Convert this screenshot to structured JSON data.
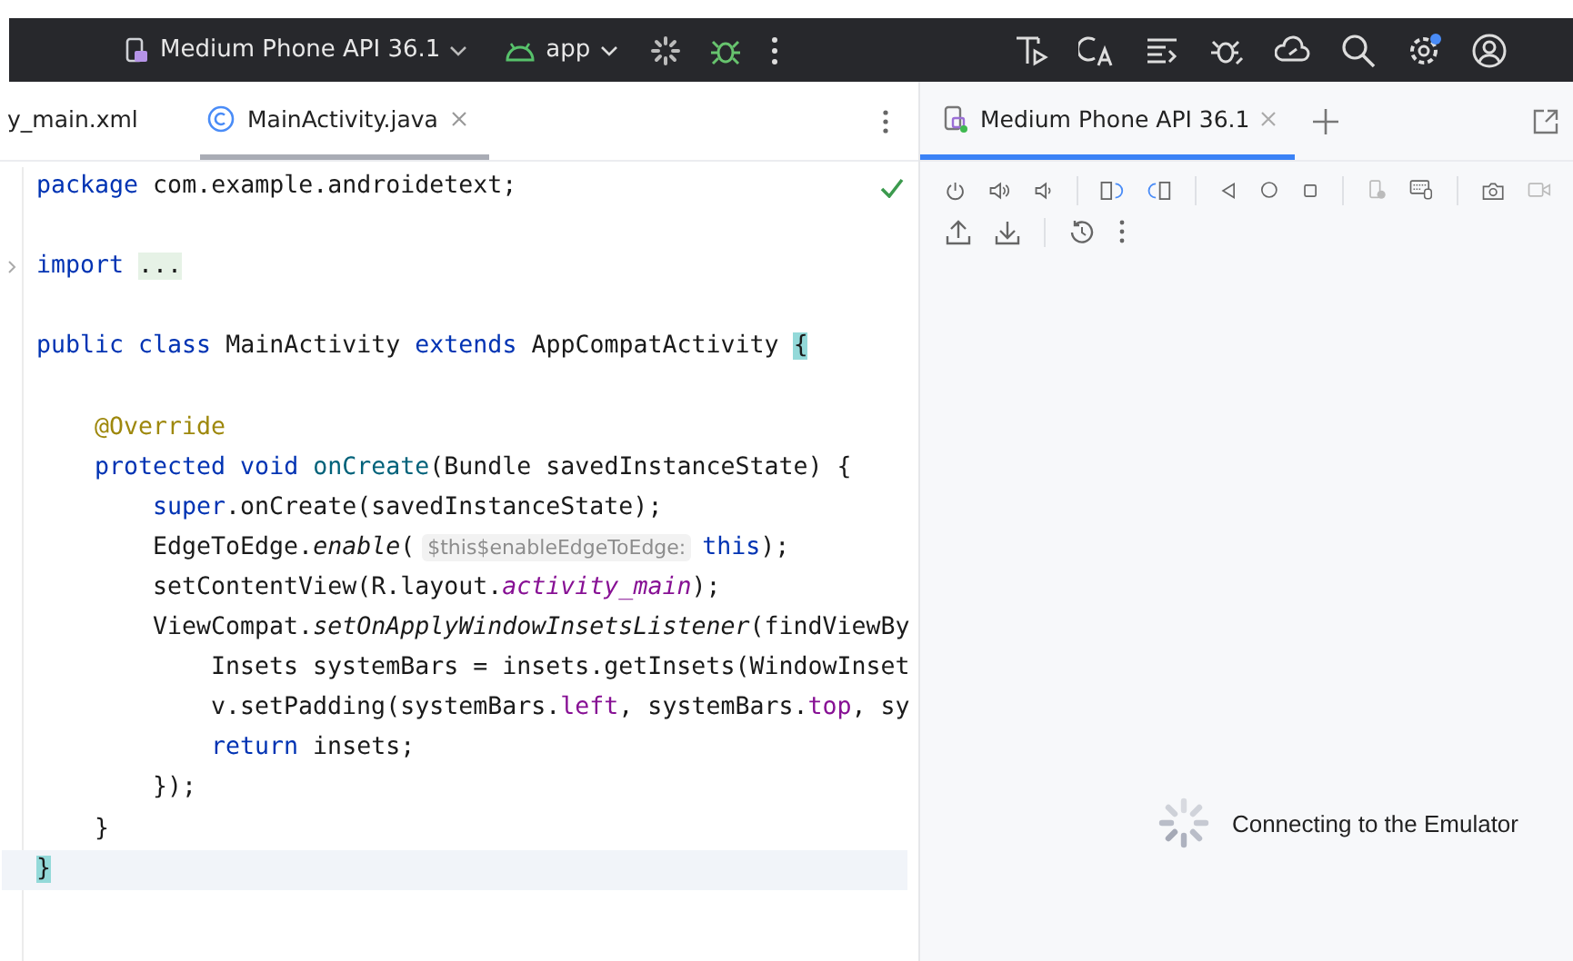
{
  "toolbar": {
    "device": "Medium Phone API 36.1",
    "config": "app"
  },
  "editor_tabs": [
    {
      "label": "y_main.xml",
      "selected": false
    },
    {
      "label": "MainActivity.java",
      "selected": true
    }
  ],
  "emulator_tabs": [
    {
      "label": "Medium Phone API 36.1",
      "selected": true
    }
  ],
  "code": [
    {
      "current": false,
      "tokens": [
        {
          "kind": "keyword",
          "text": "package"
        },
        {
          "kind": "plain",
          "text": " com.example.androidetext;"
        }
      ]
    },
    {
      "current": false
    },
    {
      "current": false,
      "folded": true,
      "tokens": [
        {
          "kind": "keyword",
          "text": "import"
        },
        {
          "kind": "folded",
          "text": "..."
        }
      ]
    },
    {
      "current": false
    },
    {
      "current": false,
      "tokens": [
        {
          "kind": "keyword",
          "text": "public class"
        },
        {
          "kind": "plain",
          "text": " MainActivity "
        },
        {
          "kind": "keyword",
          "text": "extends"
        },
        {
          "kind": "plain",
          "text": " AppCompatActivity "
        },
        {
          "kind": "brace",
          "text": "{"
        }
      ],
      "children": [
        {
          "current": false
        },
        {
          "current": false,
          "tokens": [
            {
              "kind": "annotation",
              "text": "@Override"
            }
          ]
        },
        {
          "current": false,
          "tokens": [
            {
              "kind": "keyword",
              "text": "protected void"
            },
            {
              "kind": "function",
              "text": "onCreate"
            },
            {
              "kind": "plain",
              "text": "(Bundle savedInstanceState) {"
            }
          ],
          "children": [
            {
              "current": false,
              "tokens": [
                {
                  "kind": "keyword",
                  "text": "super"
                },
                {
                  "kind": "plain",
                  "text": ".onCreate(savedInstanceState);"
                }
              ]
            },
            {
              "current": false,
              "tokens": [
                {
                  "kind": "plain",
                  "text": "EdgeToEdge."
                },
                {
                  "kind": "static",
                  "text": "enable"
                },
                {
                  "kind": "plain",
                  "text": "("
                },
                {
                  "kind": "hint",
                  "text": "$this$enableEdgeToEdge:"
                },
                {
                  "kind": "keyword",
                  "text": "this"
                },
                {
                  "kind": "plain",
                  "text": ");"
                }
              ]
            },
            {
              "current": false,
              "tokens": [
                {
                  "kind": "plain",
                  "text": "setContentView(R.layout."
                },
                {
                  "kind": "static-field",
                  "text": "activity_main"
                },
                {
                  "kind": "plain",
                  "text": ");"
                }
              ]
            },
            {
              "current": false,
              "tokens": [
                {
                  "kind": "plain",
                  "text": "ViewCompat."
                },
                {
                  "kind": "static",
                  "text": "setOnApplyWindowInsetsListener"
                },
                {
                  "kind": "plain",
                  "text": "(findViewBy"
                }
              ],
              "children": [
                {
                  "current": false,
                  "tokens": [
                    {
                      "kind": "plain",
                      "text": "Insets systemBars = insets.getInsets(WindowInset"
                    }
                  ]
                },
                {
                  "current": false,
                  "tokens": [
                    {
                      "kind": "plain",
                      "text": "v.setPadding(systemBars."
                    },
                    {
                      "kind": "field",
                      "text": "left"
                    },
                    {
                      "kind": "plain",
                      "text": ", systemBars."
                    },
                    {
                      "kind": "field",
                      "text": "top"
                    },
                    {
                      "kind": "plain",
                      "text": ", sy"
                    }
                  ]
                },
                {
                  "current": false,
                  "tokens": [
                    {
                      "kind": "keyword",
                      "text": "return"
                    },
                    {
                      "kind": "plain",
                      "text": " insets;"
                    }
                  ]
                }
              ]
            },
            {
              "current": false,
              "tokens": [
                {
                  "kind": "plain",
                  "text": "});"
                }
              ]
            }
          ]
        },
        {
          "current": false,
          "tokens": [
            {
              "kind": "plain",
              "text": "}"
            }
          ]
        }
      ]
    },
    {
      "current": true,
      "tokens": [
        {
          "kind": "brace",
          "text": "}"
        }
      ]
    }
  ],
  "emulator": {
    "status": "Connecting to the Emulator"
  }
}
